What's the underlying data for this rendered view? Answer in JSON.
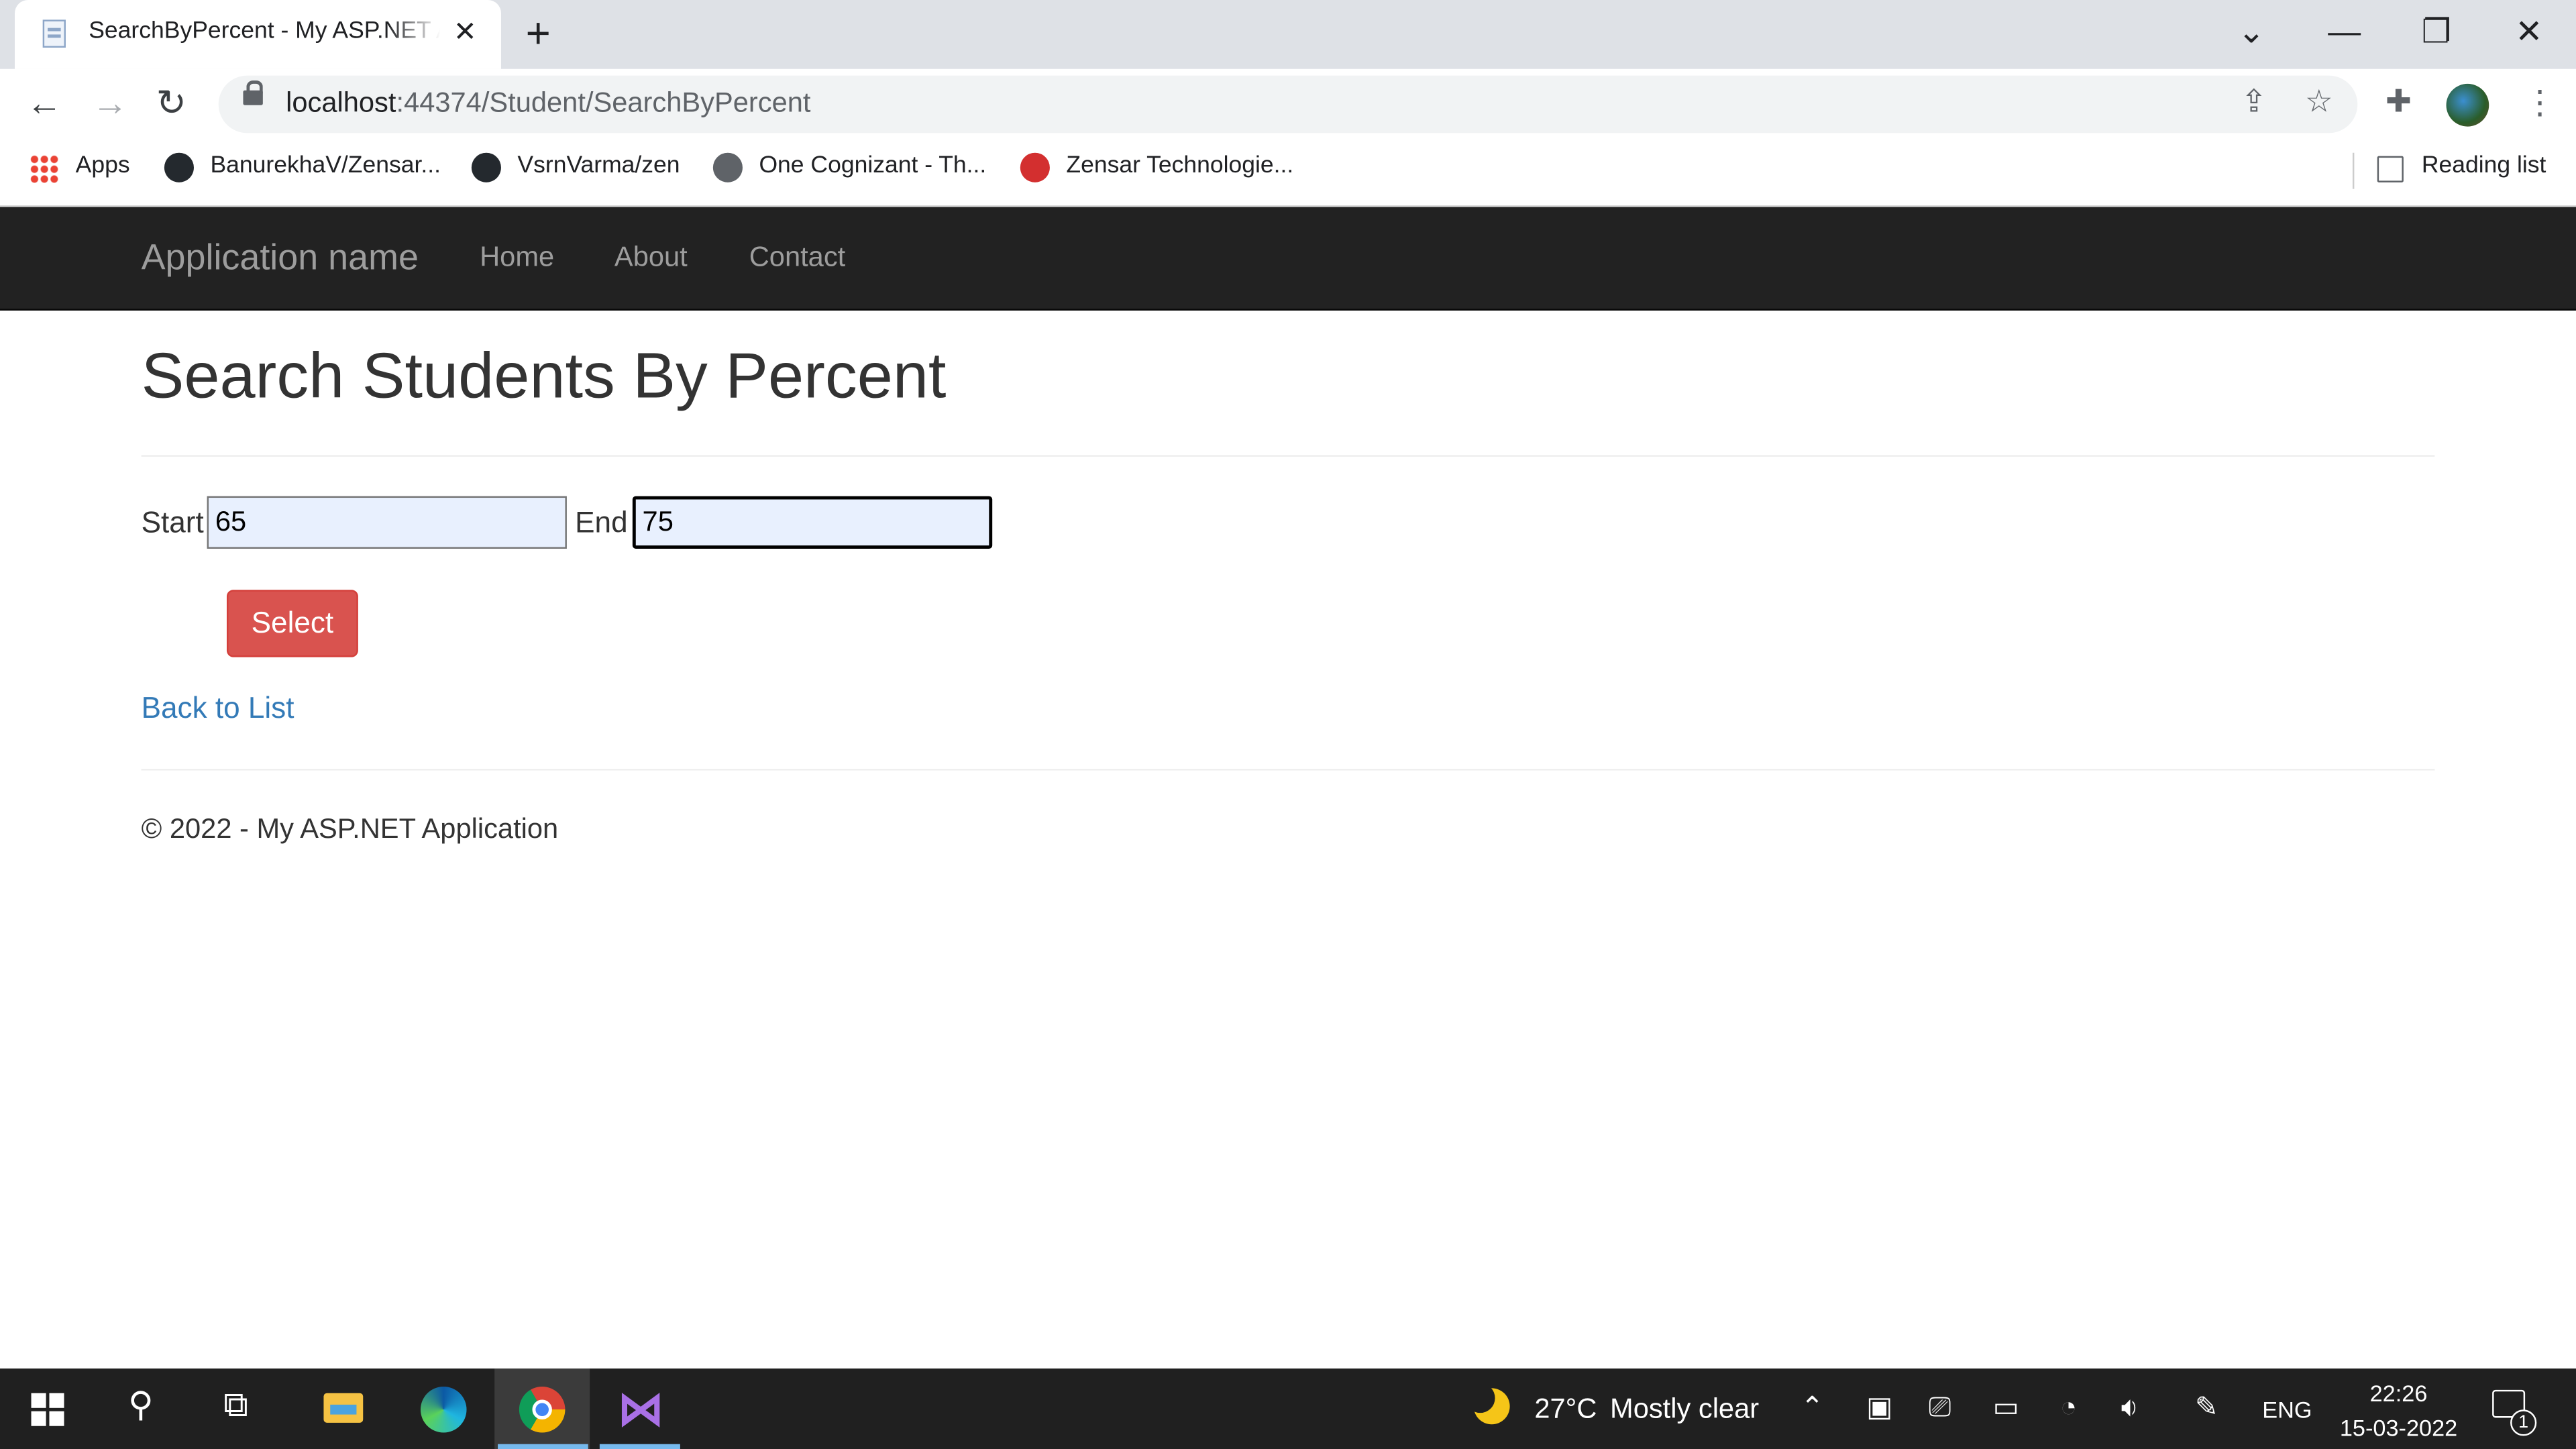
{
  "browser": {
    "tab_title": "SearchByPercent - My ASP.NET Application",
    "tab_close": "✕",
    "new_tab": "+",
    "url_host": "localhost",
    "url_path": ":44374/Student/SearchByPercent",
    "window_controls": {
      "tab_search": "⌄",
      "minimize": "—",
      "restore": "❐",
      "close": "✕"
    },
    "nav": {
      "back": "←",
      "forward": "→",
      "reload": "↻"
    },
    "bookmarks": [
      {
        "label": "Apps",
        "icon": "apps-grid-icon"
      },
      {
        "label": "BanurekhaV/Zensar...",
        "icon": "github-icon"
      },
      {
        "label": "VsrnVarma/zen",
        "icon": "github-icon"
      },
      {
        "label": "One Cognizant - Th...",
        "icon": "globe-icon"
      },
      {
        "label": "Zensar Technologie...",
        "icon": "zensar-icon"
      }
    ],
    "reading_list": "Reading list"
  },
  "site": {
    "brand": "Application name",
    "nav_links": [
      "Home",
      "About",
      "Contact"
    ],
    "page_title": "Search Students By Percent",
    "form": {
      "start_label": "Start",
      "start_value": "65",
      "end_label": "End",
      "end_value": "75",
      "submit_label": "Select"
    },
    "back_link": "Back to List",
    "footer": "© 2022 - My ASP.NET Application"
  },
  "taskbar": {
    "apps": [
      "start",
      "search",
      "task-view",
      "file-explorer",
      "edge",
      "chrome",
      "visual-studio"
    ],
    "active_app": "chrome",
    "weather_temp": "27°C",
    "weather_text": "Mostly clear",
    "language": "ENG",
    "time": "22:26",
    "date": "15-03-2022",
    "notification_count": "1"
  },
  "colors": {
    "navbar_bg": "#222222",
    "button_danger": "#d9534f",
    "link": "#337ab7",
    "autofill_bg": "#e8f0fe"
  }
}
